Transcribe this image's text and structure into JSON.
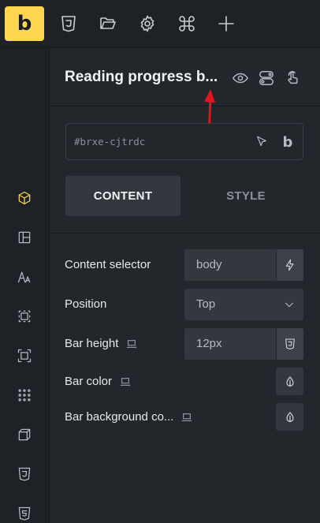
{
  "topbar": {
    "logo_letter": "b",
    "icons": [
      "css3-icon",
      "folder-open-icon",
      "gear-icon",
      "command-icon",
      "plus-icon"
    ]
  },
  "sidebar": {
    "icons": [
      "cube-icon",
      "layout-icon",
      "typography-icon",
      "spacing-icon",
      "dimensions-icon",
      "grid-dots-icon",
      "box-3d-icon",
      "css3-icon",
      "html5-icon"
    ],
    "active": "cube-icon"
  },
  "panel": {
    "title": "Reading progress b...",
    "header_icons": [
      "eye-icon",
      "toggle-icon",
      "pointer-hand-icon"
    ],
    "element_id": "#brxe-cjtrdc",
    "tabs": [
      {
        "label": "CONTENT",
        "active": true
      },
      {
        "label": "STYLE",
        "active": false
      }
    ],
    "controls": [
      {
        "label": "Content selector",
        "value": "body",
        "button_icon": "lightning-icon"
      },
      {
        "label": "Position",
        "value": "Top",
        "type": "select"
      },
      {
        "label": "Bar height",
        "value": "12px",
        "button_icon": "css3-icon",
        "responsive": true
      },
      {
        "label": "Bar color",
        "type": "color",
        "responsive": true
      },
      {
        "label": "Bar background co...",
        "type": "color",
        "responsive": true
      }
    ]
  },
  "colors": {
    "accent": "#ffd64f",
    "background": "#23262b",
    "annotation_arrow": "#e0161c"
  }
}
